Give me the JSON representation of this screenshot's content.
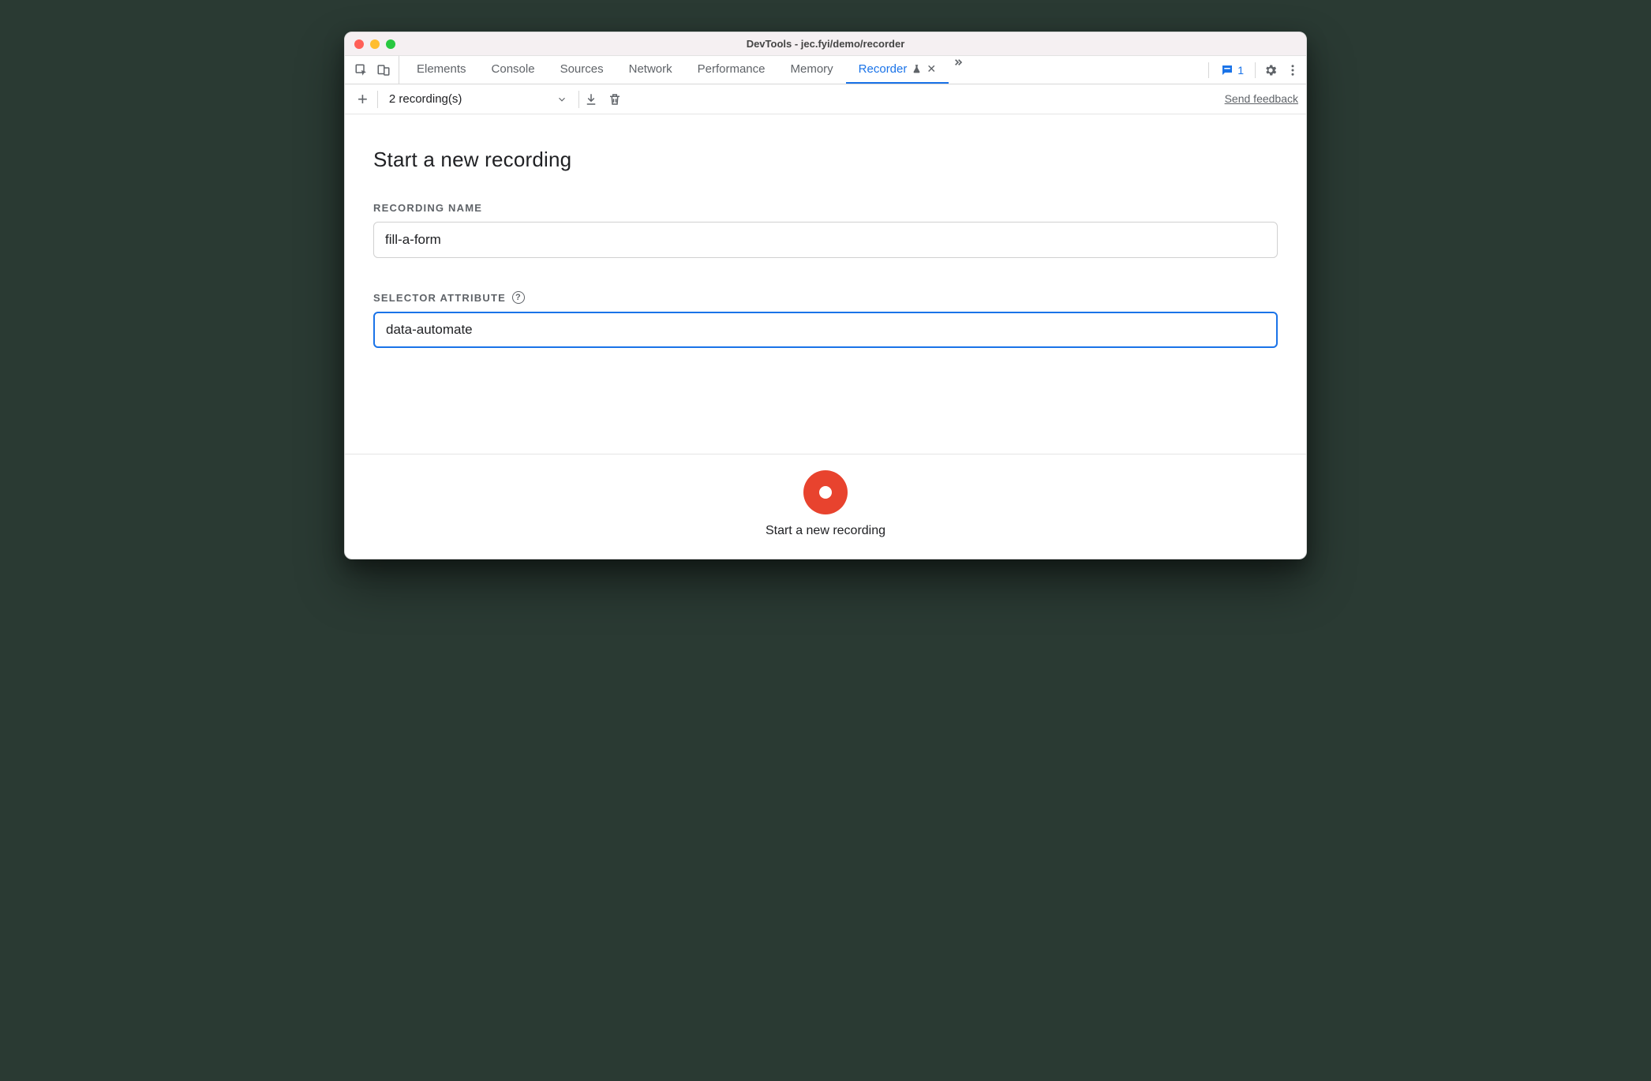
{
  "window": {
    "title": "DevTools - jec.fyi/demo/recorder"
  },
  "tabs": {
    "items": [
      {
        "label": "Elements"
      },
      {
        "label": "Console"
      },
      {
        "label": "Sources"
      },
      {
        "label": "Network"
      },
      {
        "label": "Performance"
      },
      {
        "label": "Memory"
      },
      {
        "label": "Recorder",
        "active": true,
        "experimental": true,
        "closable": true
      }
    ],
    "issues_count": "1"
  },
  "toolbar": {
    "recordings_label": "2 recording(s)",
    "send_feedback": "Send feedback"
  },
  "form": {
    "heading": "Start a new recording",
    "recording_name_label": "RECORDING NAME",
    "recording_name_value": "fill-a-form",
    "selector_attribute_label": "SELECTOR ATTRIBUTE",
    "selector_attribute_value": "data-automate"
  },
  "footer": {
    "caption": "Start a new recording"
  }
}
